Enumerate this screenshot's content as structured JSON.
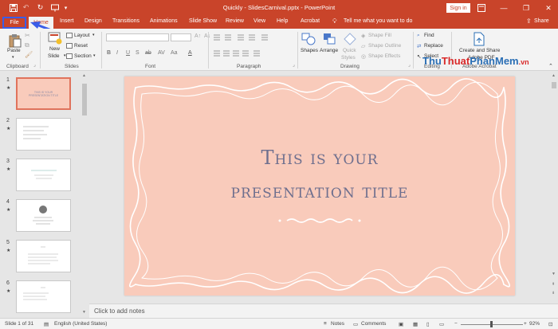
{
  "titlebar": {
    "title": "Quickly - SlidesCarnival.pptx - PowerPoint",
    "sign_in": "Sign in",
    "minimize": "—",
    "restore": "❐",
    "close": "✕"
  },
  "tabs": {
    "file": "File",
    "home": "Home",
    "items": [
      "Insert",
      "Design",
      "Transitions",
      "Animations",
      "Slide Show",
      "Review",
      "View",
      "Help",
      "Acrobat"
    ],
    "tell_me": "Tell me what you want to do",
    "share": "Share"
  },
  "ribbon": {
    "clipboard": {
      "paste": "Paste",
      "group": "Clipboard"
    },
    "slides": {
      "new_slide_1": "New",
      "new_slide_2": "Slide",
      "layout": "Layout",
      "reset": "Reset",
      "section": "Section",
      "group": "Slides"
    },
    "font": {
      "group": "Font",
      "bold": "B",
      "italic": "I",
      "underline": "U",
      "strike": "S",
      "shadow": "ab",
      "spacing": "AV",
      "case": "Aa",
      "color": "A"
    },
    "paragraph": {
      "group": "Paragraph"
    },
    "drawing": {
      "shapes": "Shapes",
      "arrange": "Arrange",
      "quick_1": "Quick",
      "quick_2": "Styles",
      "shape_fill": "Shape Fill",
      "shape_outline": "Shape Outline",
      "shape_effects": "Shape Effects",
      "group": "Drawing"
    },
    "editing": {
      "find": "Find",
      "replace": "Replace",
      "select": "Select",
      "group": "Editing"
    },
    "adobe": {
      "create_1": "Create and Share",
      "create_2": "Adobe PDF",
      "group": "Adobe Acrobat"
    }
  },
  "watermark": {
    "part1": "Thu",
    "part2": "Thuat",
    "part3": "PhanMem",
    "part4": ".vn"
  },
  "thumbnails": [
    {
      "num": "1",
      "star": "★",
      "text": "THIS IS YOUR PRESENTATION TITLE"
    },
    {
      "num": "2",
      "star": "★",
      "text": ""
    },
    {
      "num": "3",
      "star": "★",
      "text": ""
    },
    {
      "num": "4",
      "star": "★",
      "text": ""
    },
    {
      "num": "5",
      "star": "★",
      "text": ""
    },
    {
      "num": "6",
      "star": "★",
      "text": ""
    }
  ],
  "slide": {
    "title_line1": "This is your",
    "title_line2": "presentation title"
  },
  "notes": {
    "placeholder": "Click to add notes"
  },
  "status": {
    "slide_counter": "Slide 1 of 31",
    "language": "English (United States)",
    "notes": "Notes",
    "comments": "Comments",
    "zoom": "92%"
  },
  "colors": {
    "accent": "#c9442a",
    "slide_bg": "#f9cbbb",
    "title_color": "#6e6f8e",
    "file_highlight": "#3a5de8"
  }
}
